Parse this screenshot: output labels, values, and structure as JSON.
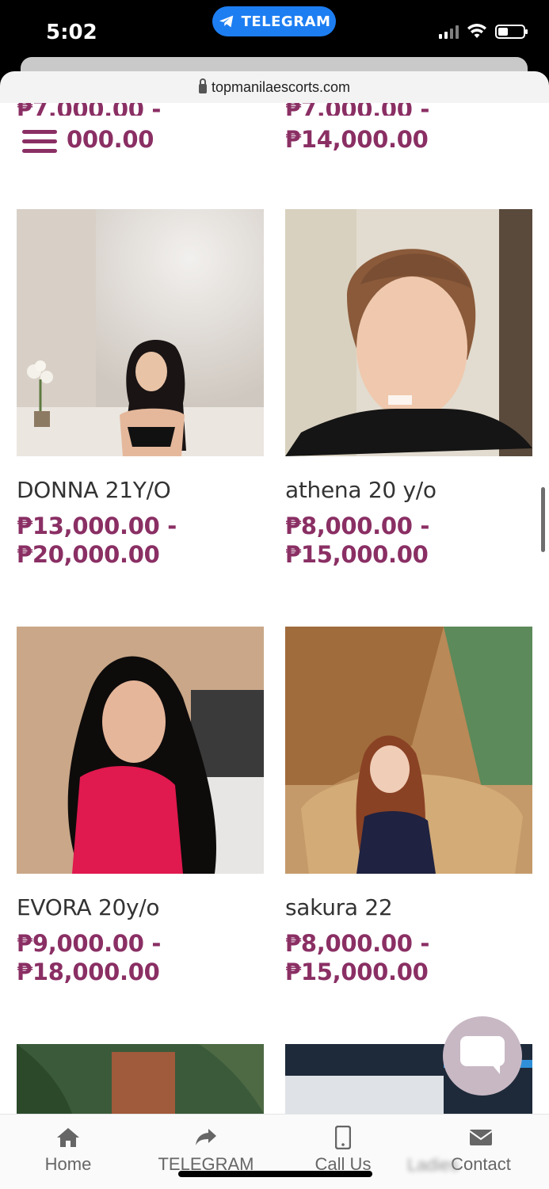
{
  "status_bar": {
    "time": "5:02",
    "telegram_pill": "TELEGRAM"
  },
  "browser": {
    "url": "topmanilaescorts.com"
  },
  "top_partial": {
    "left_price_from": "₱7,000.00 -",
    "left_price_to": "000.00",
    "right_price_from": "₱7,000.00 -",
    "right_price_to": "₱14,000.00"
  },
  "cards": [
    {
      "name": "DONNA 21Y/O",
      "price_from": "₱13,000.00 -",
      "price_to": "₱20,000.00"
    },
    {
      "name": "athena 20 y/o",
      "price_from": "₱8,000.00 -",
      "price_to": "₱15,000.00"
    },
    {
      "name": "EVORA 20y/o",
      "price_from": "₱9,000.00 -",
      "price_to": "₱18,000.00"
    },
    {
      "name": "sakura 22",
      "price_from": "₱8,000.00 -",
      "price_to": "₱15,000.00"
    }
  ],
  "bottom_nav": {
    "items": [
      {
        "label": "Home",
        "icon": "home-icon"
      },
      {
        "label": "TELEGRAM",
        "icon": "share-arrow-icon"
      },
      {
        "label": "Call Us",
        "icon": "phone-icon"
      },
      {
        "label": "Contact",
        "icon": "envelope-icon"
      }
    ],
    "blurred_overlay": "Ladies"
  },
  "colors": {
    "accent": "#8a2f64",
    "telegram": "#1d7ef2",
    "chat_bubble": "#c8b8c4"
  }
}
